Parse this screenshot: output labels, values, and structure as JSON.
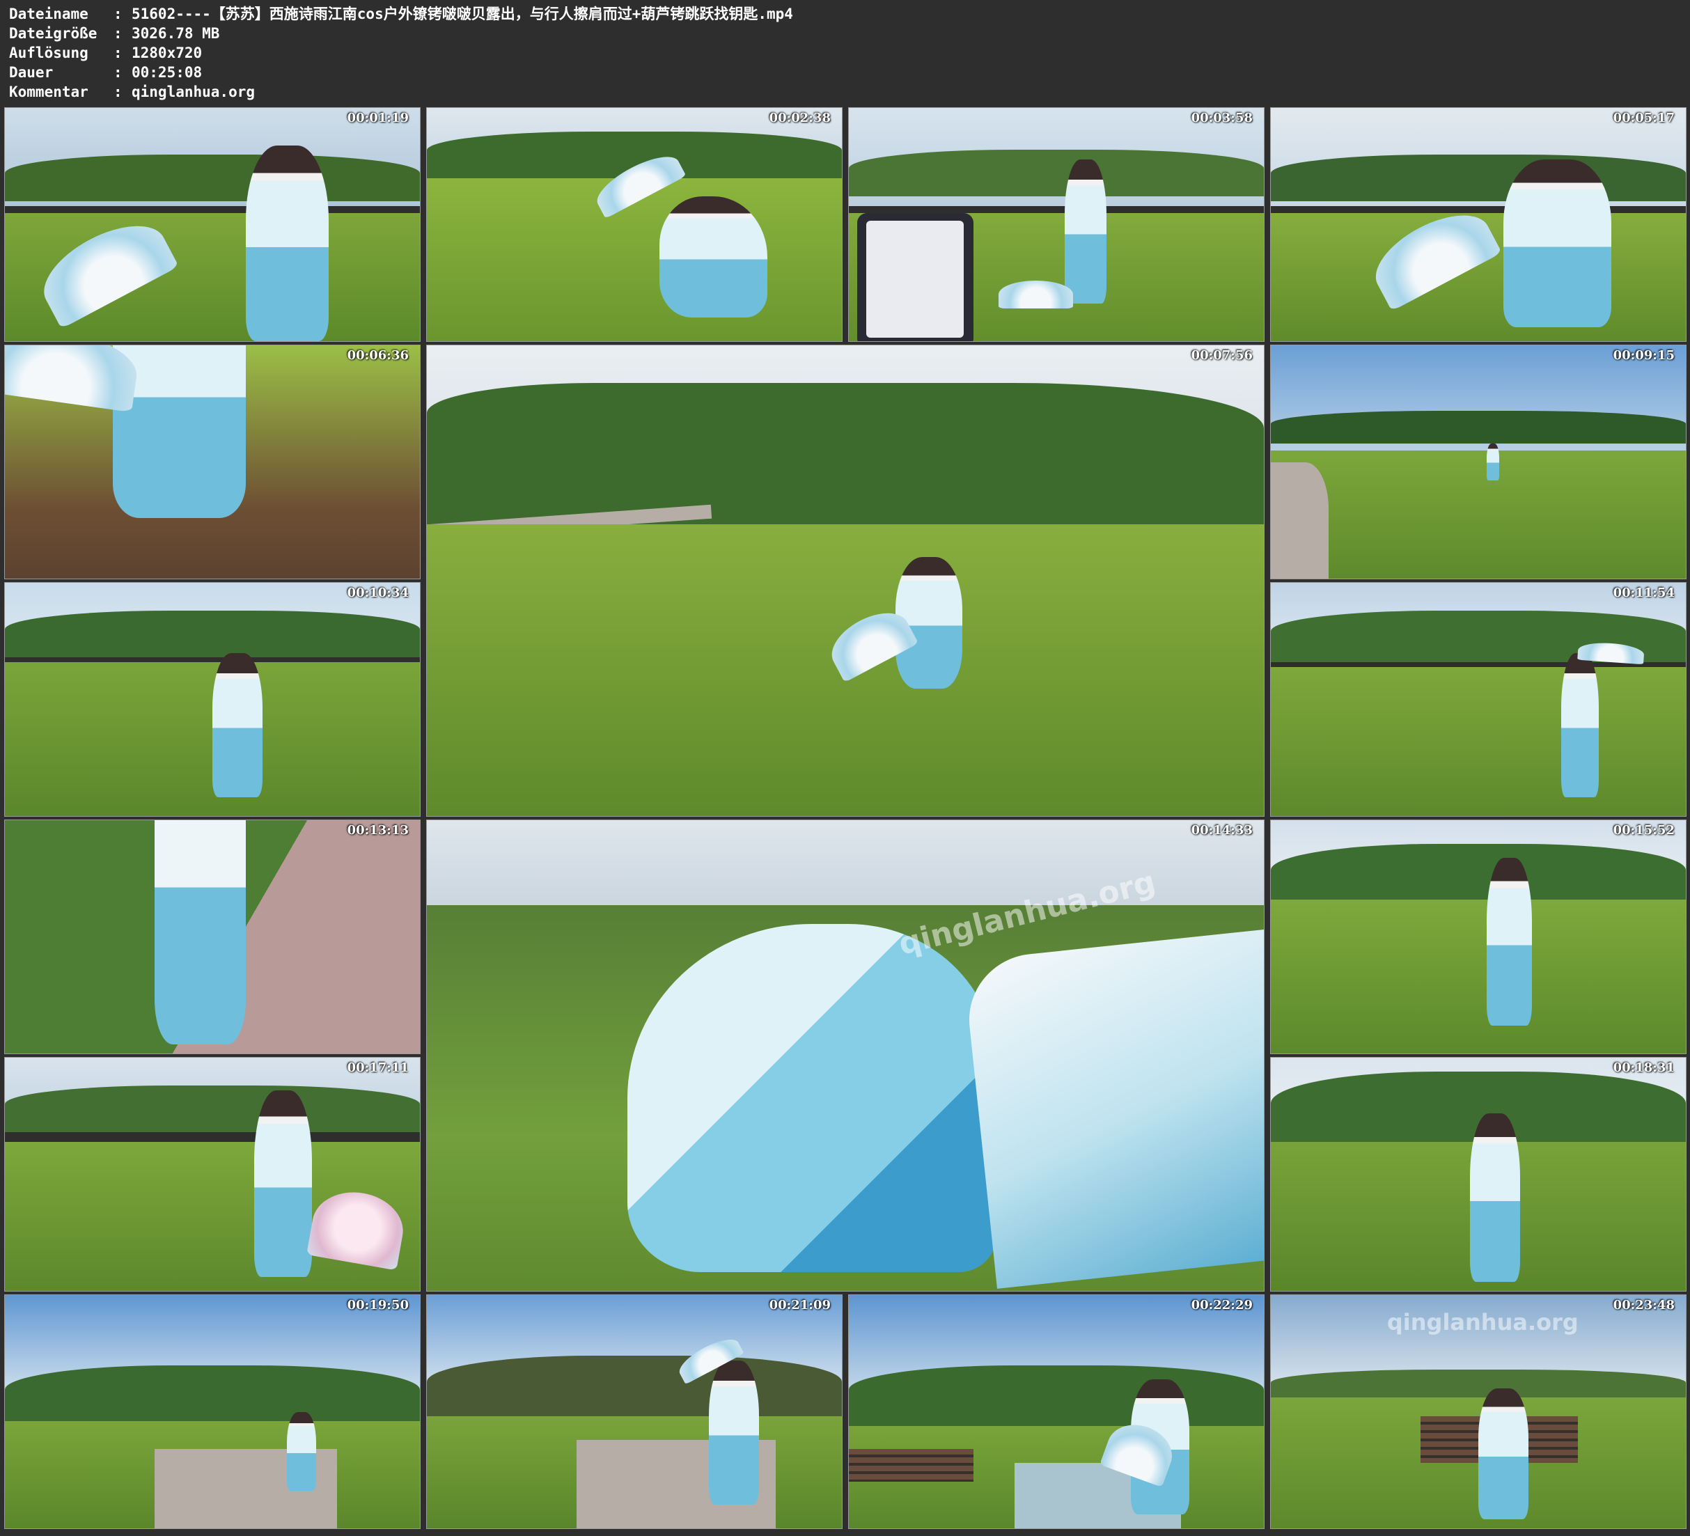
{
  "header": {
    "rows": [
      {
        "key": "Dateiname",
        "sep": ":",
        "value": "51602----【苏苏】西施诗雨江南cos户外镣铐啵啵贝露出，与行人擦肩而过+葫芦铐跳跃找钥匙.mp4"
      },
      {
        "key": "Dateigröße",
        "sep": ":",
        "value": "3026.78 MB"
      },
      {
        "key": "Auflösung",
        "sep": ":",
        "value": "1280x720"
      },
      {
        "key": "Dauer",
        "sep": ":",
        "value": "00:25:08"
      },
      {
        "key": "Kommentar",
        "sep": ":",
        "value": "qinglanhua.org"
      }
    ]
  },
  "thumbnails": [
    {
      "timestamp": "00:01:19"
    },
    {
      "timestamp": "00:02:38"
    },
    {
      "timestamp": "00:03:58"
    },
    {
      "timestamp": "00:05:17"
    },
    {
      "timestamp": "00:06:36"
    },
    {
      "timestamp": "00:07:56"
    },
    {
      "timestamp": "00:09:15"
    },
    {
      "timestamp": "00:10:34"
    },
    {
      "timestamp": "00:11:54"
    },
    {
      "timestamp": "00:13:13"
    },
    {
      "timestamp": "00:14:33"
    },
    {
      "timestamp": "00:15:52"
    },
    {
      "timestamp": "00:17:11"
    },
    {
      "timestamp": "00:18:31"
    },
    {
      "timestamp": "00:19:50"
    },
    {
      "timestamp": "00:21:09"
    },
    {
      "timestamp": "00:22:29"
    },
    {
      "timestamp": "00:23:48"
    }
  ],
  "watermarks": {
    "big_frame": "qinglanhua.org",
    "last_frame": "qinglanhua.org"
  },
  "colors": {
    "background": "#2e2e2e",
    "header_text": "#ffffff",
    "grass": "#6f9a2e",
    "sky": "#bcd3e8",
    "dress": "#6fbfdc"
  }
}
